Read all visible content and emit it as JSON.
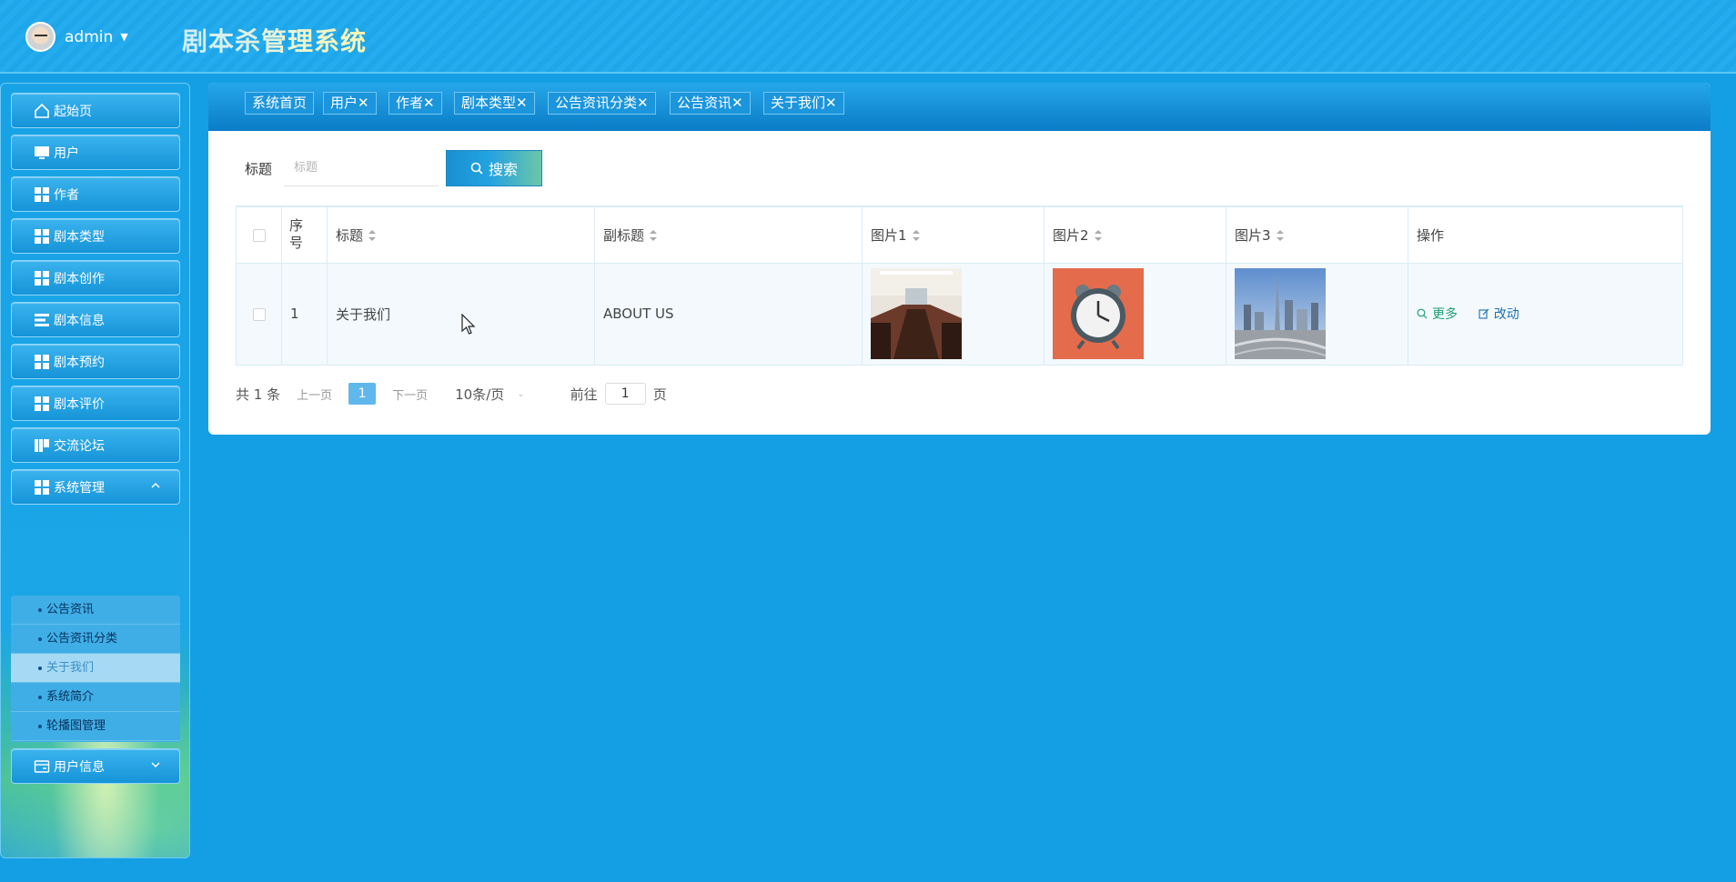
{
  "header": {
    "username": "admin",
    "app_title": "剧本杀管理系统"
  },
  "sidebar": {
    "items": [
      {
        "label": "起始页",
        "icon": "home-icon"
      },
      {
        "label": "用户",
        "icon": "monitor-icon"
      },
      {
        "label": "作者",
        "icon": "grid-icon"
      },
      {
        "label": "剧本类型",
        "icon": "grid-icon"
      },
      {
        "label": "剧本创作",
        "icon": "grid-icon"
      },
      {
        "label": "剧本信息",
        "icon": "list-icon"
      },
      {
        "label": "剧本预约",
        "icon": "grid-icon"
      },
      {
        "label": "剧本评价",
        "icon": "grid-icon"
      },
      {
        "label": "交流论坛",
        "icon": "book-icon"
      },
      {
        "label": "系统管理",
        "icon": "grid-icon",
        "expanded": true
      },
      {
        "label": "用户信息",
        "icon": "card-icon",
        "expanded": false
      }
    ],
    "submenu": [
      {
        "label": "公告资讯"
      },
      {
        "label": "公告资讯分类"
      },
      {
        "label": "关于我们",
        "active": true
      },
      {
        "label": "系统简介"
      },
      {
        "label": "轮播图管理"
      }
    ]
  },
  "tabs": [
    "系统首页",
    "用户✕",
    "作者✕",
    "剧本类型✕",
    "公告资讯分类✕",
    "公告资讯✕",
    "关于我们✕"
  ],
  "search": {
    "label": "标题",
    "placeholder": "标题",
    "value": "",
    "button_label": "搜索"
  },
  "table": {
    "headers": {
      "index": "序号",
      "title": "标题",
      "subtitle": "副标题",
      "pic1": "图片1",
      "pic2": "图片2",
      "pic3": "图片3",
      "actions": "操作"
    },
    "rows": [
      {
        "index": "1",
        "title": "关于我们",
        "subtitle": "ABOUT US",
        "pic1": "conference-room-photo",
        "pic2": "alarm-clock-illustration",
        "pic3": "city-skyline-photo",
        "more_label": "更多",
        "edit_label": "改动"
      }
    ]
  },
  "pagination": {
    "total": "共 1 条",
    "prev": "上一页",
    "current": "1",
    "next": "下一页",
    "page_size": "10条/页",
    "goto_prefix": "前往",
    "goto_value": "1",
    "goto_suffix": "页"
  },
  "colors": {
    "background": "#149fe5",
    "accent": "#5fb7ec",
    "more_link": "#1f9e70",
    "edit_link": "#1c6fb4"
  }
}
